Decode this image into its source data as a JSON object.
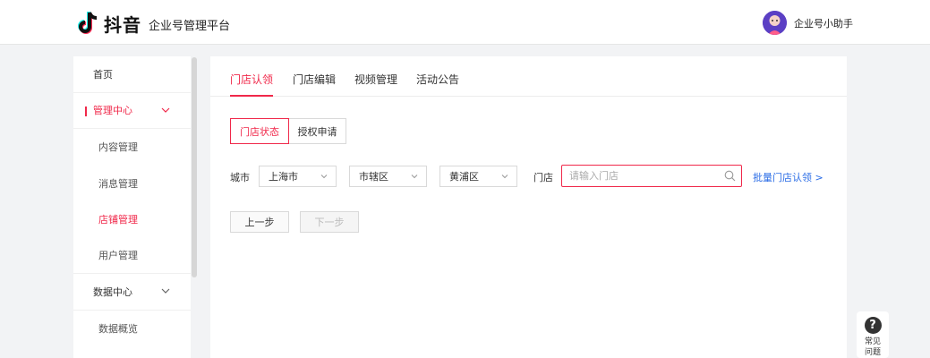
{
  "header": {
    "logo_text": "抖音",
    "platform": "企业号管理平台",
    "account_name": "企业号小助手"
  },
  "sidebar": {
    "items": [
      {
        "label": "首页"
      },
      {
        "label": "管理中心"
      },
      {
        "label": "内容管理"
      },
      {
        "label": "消息管理"
      },
      {
        "label": "店铺管理"
      },
      {
        "label": "用户管理"
      },
      {
        "label": "数据中心"
      },
      {
        "label": "数据概览"
      }
    ]
  },
  "tabs": [
    "门店认领",
    "门店编辑",
    "视频管理",
    "活动公告"
  ],
  "segments": [
    "门店状态",
    "授权申请"
  ],
  "filters": {
    "city_label": "城市",
    "city_value": "上海市",
    "district_type_value": "市辖区",
    "district_value": "黄浦区",
    "store_label": "门店",
    "store_placeholder": "请输入门店",
    "store_value": "",
    "batch_link": "批量门店认领 >"
  },
  "buttons": {
    "prev": "上一步",
    "next": "下一步"
  },
  "help": {
    "label": "常见问题"
  },
  "colors": {
    "accent": "#f0284a",
    "link": "#2b6de6"
  }
}
